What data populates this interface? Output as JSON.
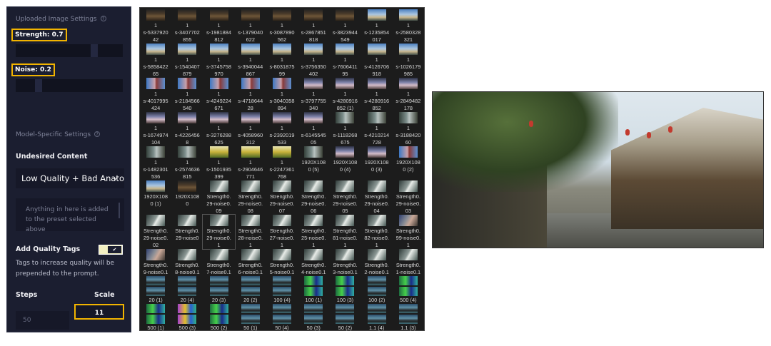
{
  "panel": {
    "uploaded_title": "Uploaded Image Settings",
    "strength_label": "Strength: 0.7",
    "strength_value": 0.7,
    "noise_label": "Noise: 0.2",
    "noise_value": 0.2,
    "model_title": "Model-Specific Settings",
    "undesired_label": "Undesired Content",
    "undesired_select": "Low Quality + Bad Anatomy",
    "undesired_placeholder": "Anything in here is added to the preset selected above",
    "quality_tags_label": "Add Quality Tags",
    "quality_tags_on": true,
    "quality_tags_desc": "Tags to increase quality will be prepended to the prompt.",
    "steps_label": "Steps",
    "scale_label": "Scale",
    "steps_value": "50",
    "scale_value": "11",
    "highlight_color": "#f2b400"
  },
  "files": [
    {
      "label": "1\ns-5337920\n42",
      "thumb": "temple"
    },
    {
      "label": "1\ns-3407702\n855",
      "thumb": "temple"
    },
    {
      "label": "1\ns-1981884\n812",
      "thumb": "temple"
    },
    {
      "label": "1\ns-1379040\n622",
      "thumb": "temple"
    },
    {
      "label": "1\ns-3087890\n562",
      "thumb": "temple"
    },
    {
      "label": "1\ns-2867851\n818",
      "thumb": "temple"
    },
    {
      "label": "1\ns-3823944\n549",
      "thumb": "temple"
    },
    {
      "label": "1\ns-1235854\n017",
      "thumb": "lake"
    },
    {
      "label": "1\ns-2580328\n321",
      "thumb": "lake"
    },
    {
      "label": "1\ns-5858422\n65",
      "thumb": "lake"
    },
    {
      "label": "1\ns-1540407\n879",
      "thumb": "lake"
    },
    {
      "label": "1\ns-3745758\n970",
      "thumb": "lake"
    },
    {
      "label": "1\ns-3940044\n867",
      "thumb": "lake"
    },
    {
      "label": "1\ns-8031875\n99",
      "thumb": "lake"
    },
    {
      "label": "1\ns-3756350\n402",
      "thumb": "lake"
    },
    {
      "label": "1\ns-7606411\n95",
      "thumb": "lake"
    },
    {
      "label": "1\ns-4126706\n918",
      "thumb": "lake"
    },
    {
      "label": "1\ns-1026179\n985",
      "thumb": "lake"
    },
    {
      "label": "1\ns-4017995\n424",
      "thumb": "pagoda"
    },
    {
      "label": "1\ns-2184566\n540",
      "thumb": "pagoda"
    },
    {
      "label": "1\ns-4249224\n671",
      "thumb": "pagoda"
    },
    {
      "label": "1\ns-4718644\n28",
      "thumb": "pagoda"
    },
    {
      "label": "1\ns-3040358\n894",
      "thumb": "pagoda"
    },
    {
      "label": "1\ns-3797755\n340",
      "thumb": "bridge"
    },
    {
      "label": "1\ns-4280916\n852 (1)",
      "thumb": "bridge"
    },
    {
      "label": "1\ns-4280916\n852",
      "thumb": "bridge"
    },
    {
      "label": "1\ns-2849482\n178",
      "thumb": "bridge"
    },
    {
      "label": "1\ns-1674974\n104",
      "thumb": "bridge"
    },
    {
      "label": "1\ns-4226456\n8",
      "thumb": "bridge"
    },
    {
      "label": "1\ns-3276288\n625",
      "thumb": "bridge"
    },
    {
      "label": "1\ns-4058960\n312",
      "thumb": "bridge"
    },
    {
      "label": "1\ns-2392019\n533",
      "thumb": "bridge"
    },
    {
      "label": "1\ns-6145545\n05",
      "thumb": "bridge"
    },
    {
      "label": "1\ns-1118268\n675",
      "thumb": "street"
    },
    {
      "label": "1\ns-4210214\n728",
      "thumb": "street"
    },
    {
      "label": "1\ns-3188420\n60",
      "thumb": "street"
    },
    {
      "label": "1\ns-1482301\n536",
      "thumb": "street"
    },
    {
      "label": "1\ns-2574636\n815",
      "thumb": "street"
    },
    {
      "label": "1\ns-1501935\n399",
      "thumb": "yellow"
    },
    {
      "label": "1\ns-2904646\n771",
      "thumb": "yellow"
    },
    {
      "label": "1\ns-2247361\n768",
      "thumb": "yellow"
    },
    {
      "label": "1920X108\n0 (5)",
      "thumb": "street"
    },
    {
      "label": "1920X108\n0 (4)",
      "thumb": "bridge"
    },
    {
      "label": "1920X108\n0 (3)",
      "thumb": "bridge"
    },
    {
      "label": "1920X108\n0 (2)",
      "thumb": "pagoda"
    },
    {
      "label": "1920X108\n0 (1)",
      "thumb": "lake"
    },
    {
      "label": "1920X108\n0",
      "thumb": "temple"
    },
    {
      "label": "Strength0.\n29-noise0.\n09",
      "thumb": "gray"
    },
    {
      "label": "Strength0.\n29-noise0.\n08",
      "thumb": "gray"
    },
    {
      "label": "Strength0.\n29-noise0.\n07",
      "thumb": "gray"
    },
    {
      "label": "Strength0.\n29-noise0.\n06",
      "thumb": "gray"
    },
    {
      "label": "Strength0.\n29-noise0.\n05",
      "thumb": "gray"
    },
    {
      "label": "Strength0.\n29-noise0.\n04",
      "thumb": "gray"
    },
    {
      "label": "Strength0.\n29-noise0.\n03",
      "thumb": "gray"
    },
    {
      "label": "Strength0.\n29-noise0.\n02",
      "thumb": "gray"
    },
    {
      "label": "Strength0.\n29-noise0",
      "thumb": "gray"
    },
    {
      "label": "Strength0.\n29-noise0.\n1",
      "thumb": "gray",
      "selected": true
    },
    {
      "label": "Strength0.\n28-noise0.\n1",
      "thumb": "gray"
    },
    {
      "label": "Strength0.\n27-noise0.\n1",
      "thumb": "gray"
    },
    {
      "label": "Strength0.\n25-noise0.\n1",
      "thumb": "gray"
    },
    {
      "label": "Strength0.\n81-noise0.\n1",
      "thumb": "gray"
    },
    {
      "label": "Strength0.\n82-noise0.\n1",
      "thumb": "gray"
    },
    {
      "label": "Strength0.\n99-noise0.\n1",
      "thumb": "cliff"
    },
    {
      "label": "Strength0.\n9-noise0.1",
      "thumb": "cliff"
    },
    {
      "label": "Strength0.\n8-noise0.1",
      "thumb": "gray"
    },
    {
      "label": "Strength0.\n7-noise0.1",
      "thumb": "gray"
    },
    {
      "label": "Strength0.\n6-noise0.1",
      "thumb": "gray"
    },
    {
      "label": "Strength0.\n5-noise0.1",
      "thumb": "gray"
    },
    {
      "label": "Strength0.\n4-noise0.1",
      "thumb": "gray"
    },
    {
      "label": "Strength0.\n3-noise0.1",
      "thumb": "gray"
    },
    {
      "label": "Strength0.\n2-noise0.1",
      "thumb": "gray"
    },
    {
      "label": "Strength0.\n1-noise0.1",
      "thumb": "gray"
    },
    {
      "label": "20 (1)",
      "thumb": "teal",
      "double": true
    },
    {
      "label": "20 (4)",
      "thumb": "teal",
      "double": true
    },
    {
      "label": "20 (3)",
      "thumb": "teal",
      "double": true
    },
    {
      "label": "20 (2)",
      "thumb": "teal",
      "double": true
    },
    {
      "label": "100 (4)",
      "thumb": "teal",
      "double": true
    },
    {
      "label": "100 (1)",
      "thumb": "neon",
      "double": true
    },
    {
      "label": "100 (3)",
      "thumb": "neon",
      "double": true
    },
    {
      "label": "100 (2)",
      "thumb": "teal",
      "double": true
    },
    {
      "label": "500 (4)",
      "thumb": "neon",
      "double": true
    },
    {
      "label": "500 (1)",
      "thumb": "neon",
      "double": true
    },
    {
      "label": "500 (3)",
      "thumb": "psy",
      "double": true
    },
    {
      "label": "500 (2)",
      "thumb": "neon",
      "double": true
    },
    {
      "label": "50 (1)",
      "thumb": "teal",
      "double": true
    },
    {
      "label": "50 (4)",
      "thumb": "teal",
      "double": true
    },
    {
      "label": "50 (3)",
      "thumb": "teal",
      "double": true
    },
    {
      "label": "50 (2)",
      "thumb": "teal",
      "double": true
    },
    {
      "label": "1.1 (4)",
      "thumb": "teal",
      "double": true
    },
    {
      "label": "1.1 (3)",
      "thumb": "teal",
      "double": true
    }
  ]
}
